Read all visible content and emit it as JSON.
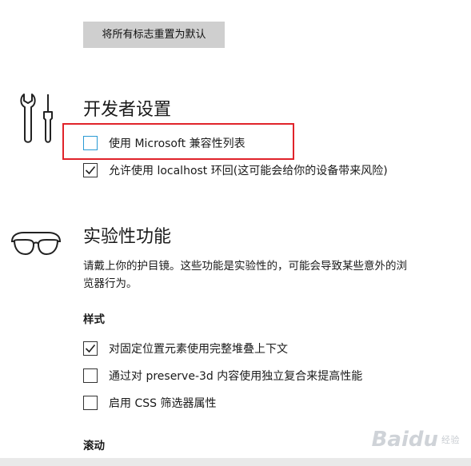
{
  "reset_button": {
    "label": "将所有标志重置为默认"
  },
  "developer_settings": {
    "title": "开发者设置",
    "options": [
      {
        "label": "使用 Microsoft 兼容性列表",
        "checked": false
      },
      {
        "label": "允许使用 localhost 环回(这可能会给你的设备带来风险)",
        "checked": true
      }
    ]
  },
  "experimental": {
    "title": "实验性功能",
    "description": "请戴上你的护目镜。这些功能是实验性的，可能会导致某些意外的浏览器行为。",
    "styles_heading": "样式",
    "style_options": [
      {
        "label": "对固定位置元素使用完整堆叠上下文",
        "checked": true
      },
      {
        "label": "通过对 preserve-3d 内容使用独立复合来提高性能",
        "checked": false
      },
      {
        "label": "启用 CSS 筛选器属性",
        "checked": false
      }
    ],
    "scroll_heading": "滚动"
  },
  "watermark": {
    "logo": "Baidu",
    "sub": "经验"
  },
  "colors": {
    "highlight": "#e0232a",
    "focus_border": "#2a9ad4",
    "button_bg": "#cfcfcf"
  }
}
